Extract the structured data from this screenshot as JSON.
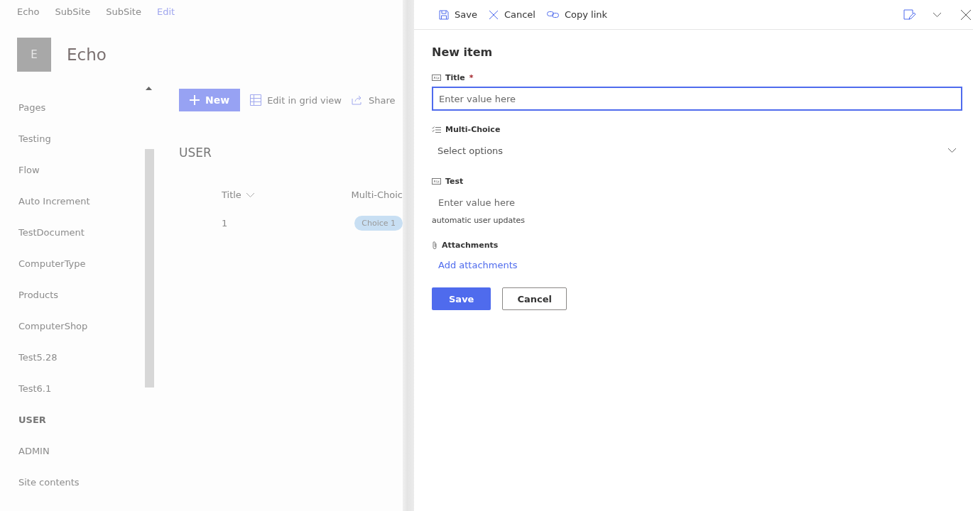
{
  "top_nav": [
    {
      "label": "Echo",
      "kind": "site"
    },
    {
      "label": "SubSite",
      "kind": "site"
    },
    {
      "label": "SubSite",
      "kind": "site"
    },
    {
      "label": "Edit",
      "kind": "edit"
    }
  ],
  "site": {
    "logo_letter": "E",
    "title": "Echo"
  },
  "sidebar": {
    "items": [
      {
        "label": "Pages",
        "selected": false
      },
      {
        "label": "Testing",
        "selected": false
      },
      {
        "label": "Flow",
        "selected": false
      },
      {
        "label": "Auto Increment",
        "selected": false
      },
      {
        "label": "TestDocument",
        "selected": false
      },
      {
        "label": "ComputerType",
        "selected": false
      },
      {
        "label": "Products",
        "selected": false
      },
      {
        "label": "ComputerShop",
        "selected": false
      },
      {
        "label": "Test5.28",
        "selected": false
      },
      {
        "label": "Test6.1",
        "selected": false
      },
      {
        "label": "USER",
        "selected": true
      },
      {
        "label": "ADMIN",
        "selected": false
      },
      {
        "label": "Site contents",
        "selected": false
      }
    ]
  },
  "command_bar": {
    "new_label": "New",
    "grid_label": "Edit in grid view",
    "share_label": "Share"
  },
  "list": {
    "title": "USER",
    "columns": [
      "Title",
      "Multi-Choic"
    ],
    "rows": [
      {
        "title": "1",
        "choice": "Choice 1"
      }
    ]
  },
  "panel": {
    "toolbar": [
      {
        "label": "Save",
        "kind": "save"
      },
      {
        "label": "Cancel",
        "kind": "cancel"
      },
      {
        "label": "Copy link",
        "kind": "link"
      }
    ],
    "heading": "New item",
    "fields": [
      {
        "kind": "text",
        "label": "Title",
        "required_mark": "*",
        "focused": true,
        "placeholder": "Enter value here"
      },
      {
        "kind": "choice",
        "label": "Multi-Choice",
        "focused": false,
        "placeholder": "Select options"
      },
      {
        "kind": "text",
        "label": "Test",
        "focused": false,
        "placeholder": "Enter value here",
        "description": "automatic user updates"
      },
      {
        "kind": "attachments",
        "label": "Attachments",
        "link": "Add attachments"
      }
    ],
    "buttons": [
      {
        "label": "Save",
        "kind": "primary"
      },
      {
        "label": "Cancel",
        "kind": "secondary"
      }
    ]
  }
}
